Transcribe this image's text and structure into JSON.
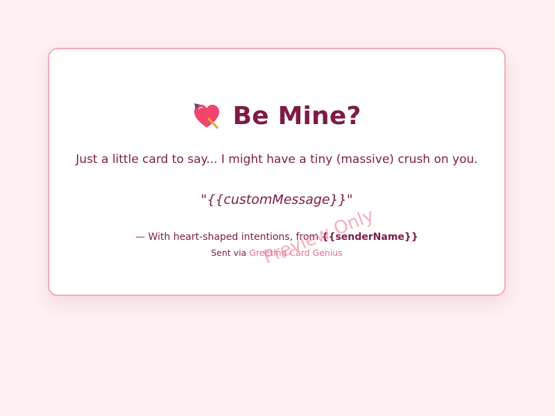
{
  "card": {
    "title": "Be Mine?",
    "title_icon": "heart-with-arrow-icon",
    "tagline": "Just a little card to say... I might have a tiny (massive) crush on you.",
    "message": "\"{{customMessage}}\"",
    "signature_prefix": "— With heart-shaped intentions, from ",
    "sender_name": "{{senderName}}",
    "sent_via_prefix": "Sent via ",
    "sent_via_link": "Greeting Card Genius"
  },
  "watermark": "Preview Only",
  "colors": {
    "page_background": "#fff0f2",
    "card_border": "#f4a9b4",
    "text": "#7d1b46",
    "link": "#ec6a8a",
    "heart": "#f0456c"
  }
}
